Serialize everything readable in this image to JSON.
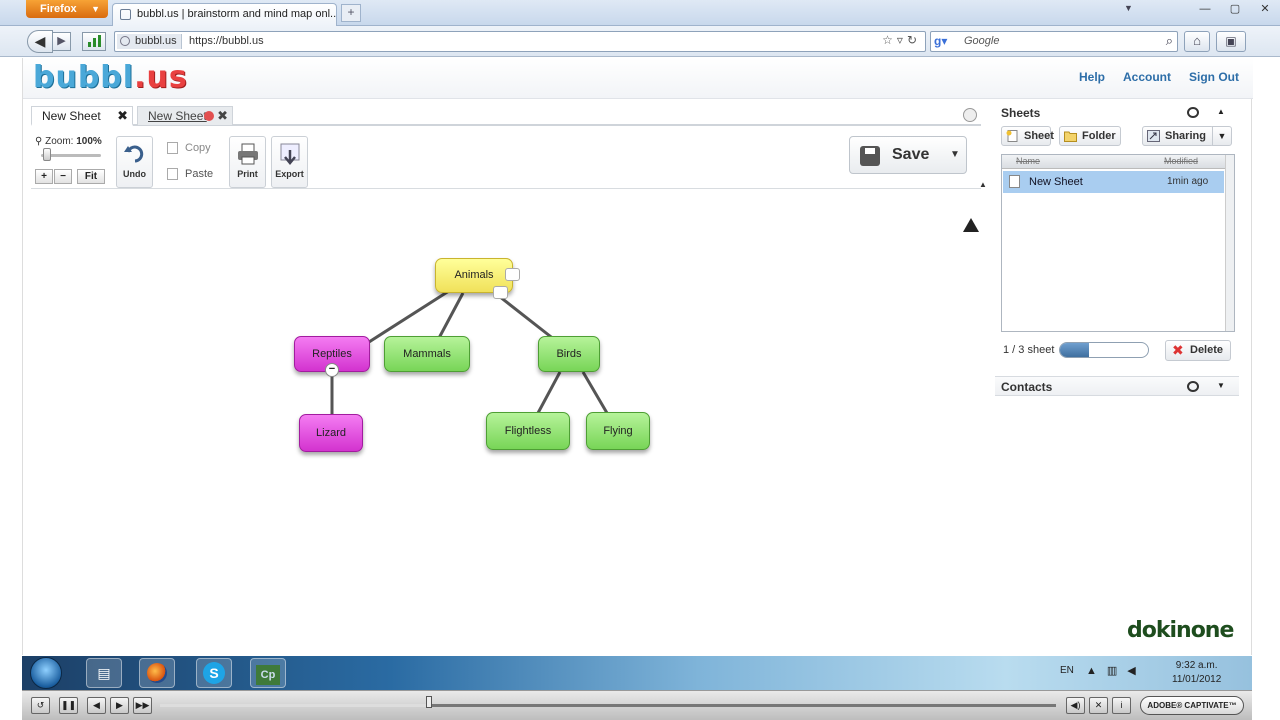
{
  "browser": {
    "app_button": "Firefox",
    "tab_title": "bubbl.us | brainstorm and mind map onl...",
    "url_site": "bubbl.us",
    "url": "https://bubbl.us",
    "search_placeholder": "Google"
  },
  "header": {
    "logo_left": "bubbl",
    "logo_right": ".us",
    "links": [
      "Help",
      "Account",
      "Sign Out"
    ]
  },
  "sheet_tabs": [
    "New Sheet",
    "New Sheet"
  ],
  "toolbar": {
    "zoom_prefix": "Zoom:",
    "zoom_value": "100%",
    "zoom_level": 0.1,
    "zoom_in": "+",
    "zoom_out": "−",
    "fit": "Fit",
    "undo": "Undo",
    "copy": "Copy",
    "paste": "Paste",
    "print": "Print",
    "export": "Export",
    "save": "Save"
  },
  "mindmap": {
    "nodes": {
      "animals": "Animals",
      "reptiles": "Reptiles",
      "mammals": "Mammals",
      "birds": "Birds",
      "lizard": "Lizard",
      "flightless": "Flightless",
      "flying": "Flying"
    },
    "collapse_symbol": "−"
  },
  "sheets_panel": {
    "title": "Sheets",
    "buttons": {
      "sheet": "Sheet",
      "folder": "Folder",
      "sharing": "Sharing"
    },
    "columns": [
      "Name",
      "Modified"
    ],
    "rows": [
      {
        "name": "New Sheet",
        "modified": "1min ago"
      }
    ],
    "pager": "1 / 3 sheet",
    "quota_fill": 0.33,
    "delete": "Delete"
  },
  "contacts": {
    "title": "Contacts"
  },
  "watermark": "dokinone",
  "taskbar": {
    "lang": "EN",
    "time": "9:32 a.m.",
    "date": "11/01/2012",
    "captivate_label": "Cp"
  },
  "player": {
    "badge": "ADOBE® CAPTIVATE™",
    "progress": 0.3
  },
  "colors": {
    "node_yellow": "#f0e15a",
    "node_pink": "#d333cf",
    "node_green": "#78d557",
    "link_blue": "#2d6ea8"
  }
}
